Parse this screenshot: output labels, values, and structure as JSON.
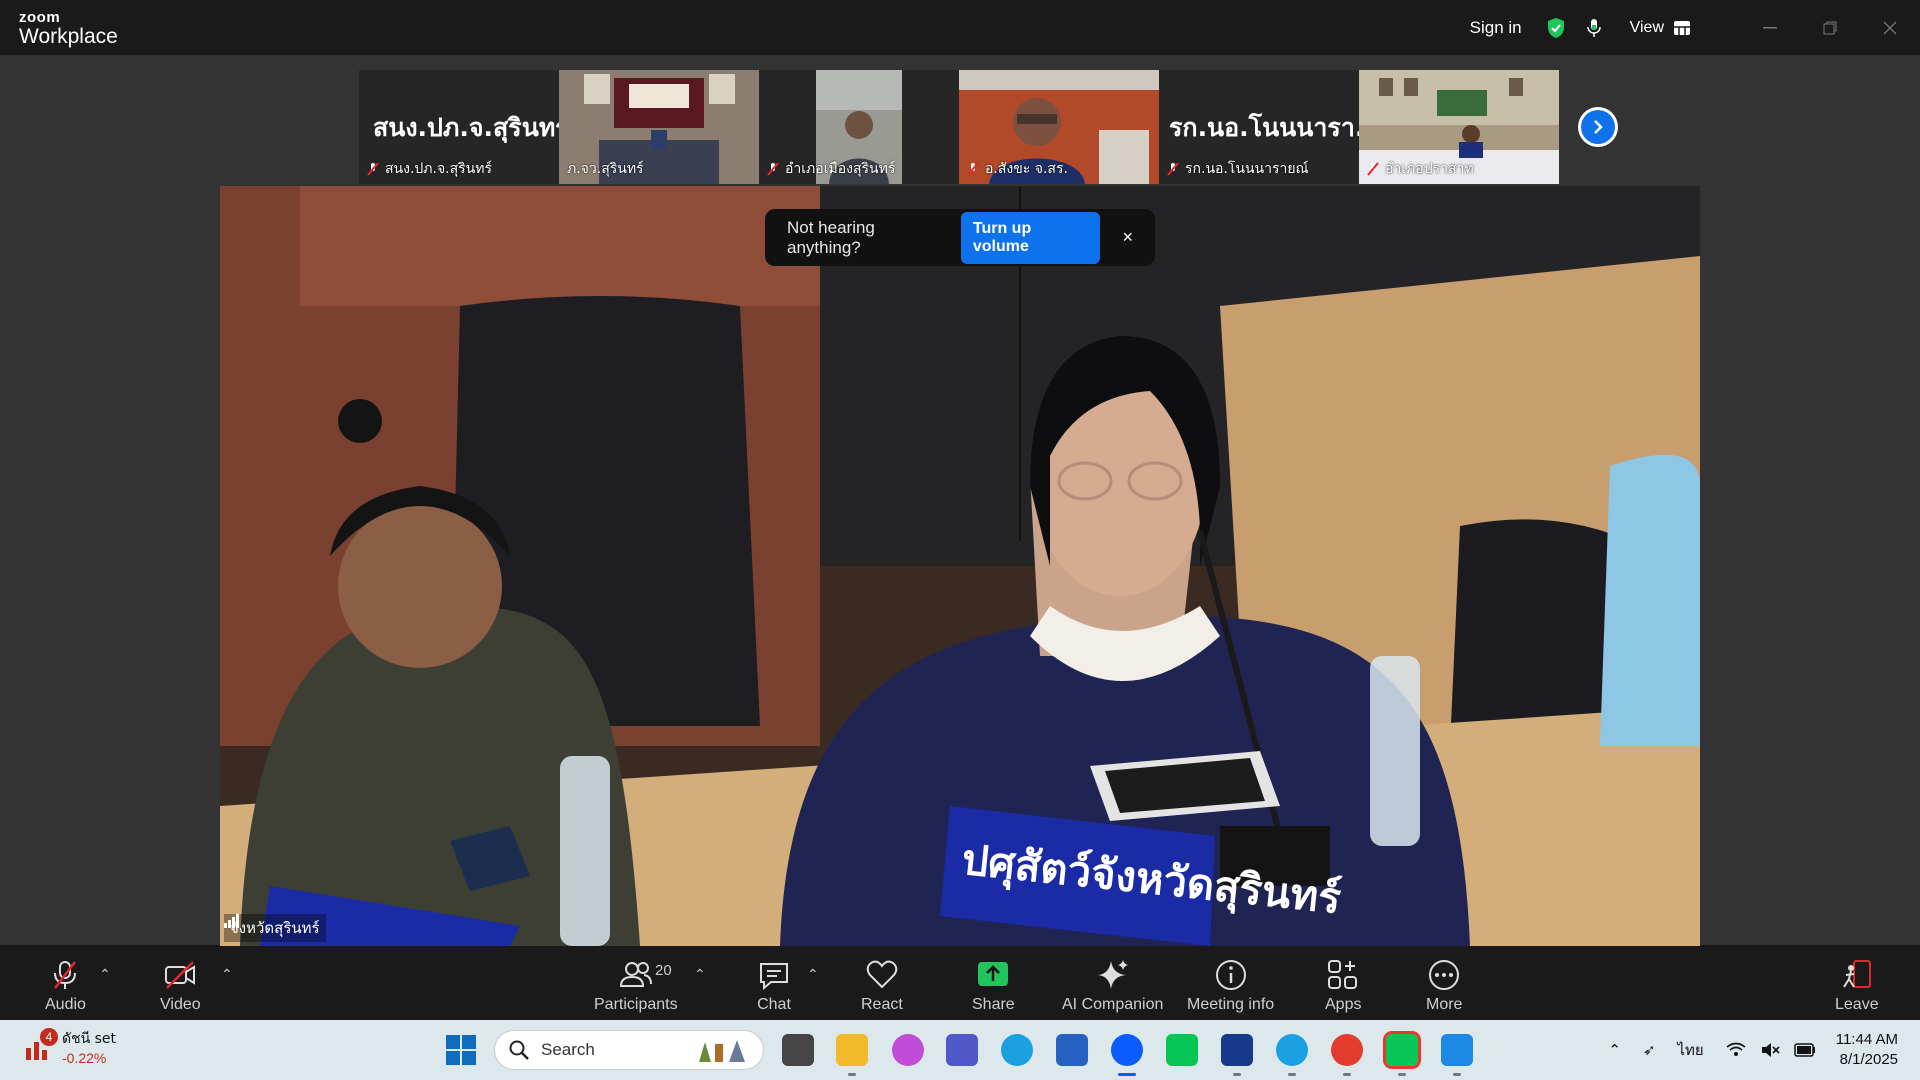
{
  "titlebar": {
    "logo_top": "zoom",
    "logo_bottom": "Workplace",
    "sign_in": "Sign in",
    "view": "View"
  },
  "thumbnails": [
    {
      "big_name": "สนง.ปภ.จ.สุรินทร์",
      "label": "สนง.ปภ.จ.สุรินทร์",
      "type": "name"
    },
    {
      "big_name": "",
      "label": "ภ.จว.สุรินทร์",
      "type": "video-room"
    },
    {
      "big_name": "",
      "label": "อำเภอเมืองสุรินทร์",
      "type": "video-person"
    },
    {
      "big_name": "",
      "label": "อ.สังขะ จ.สร.",
      "type": "video-person2"
    },
    {
      "big_name": "รก.นอ.โนนนารา...",
      "label": "รก.นอ.โนนนารายณ์",
      "type": "name"
    },
    {
      "big_name": "",
      "label": "อำเภอปราสาท",
      "type": "video-room2"
    }
  ],
  "main_video": {
    "speaker_label": "จังหวัดสุรินทร์",
    "nameplate": "ปศุสัตว์จังหวัดสุรินทร์"
  },
  "toast": {
    "message": "Not hearing anything?",
    "button": "Turn up volume",
    "close": "×"
  },
  "toolbar": {
    "audio": "Audio",
    "video": "Video",
    "participants": "Participants",
    "participants_count": "20",
    "chat": "Chat",
    "react": "React",
    "share": "Share",
    "ai_companion": "AI Companion",
    "meeting_info": "Meeting info",
    "apps": "Apps",
    "more": "More",
    "leave": "Leave"
  },
  "taskbar": {
    "stock_name": "ดัชนี set",
    "stock_change": "-0.22%",
    "stock_badge": "4",
    "search_placeholder": "Search",
    "lang": "ไทย",
    "time": "11:44 AM",
    "date": "8/1/2025"
  },
  "colors": {
    "accent": "#0e72ed",
    "share_green": "#21c55d",
    "stage_bg": "#333333",
    "toolbar_bg": "#1a1a1a"
  }
}
